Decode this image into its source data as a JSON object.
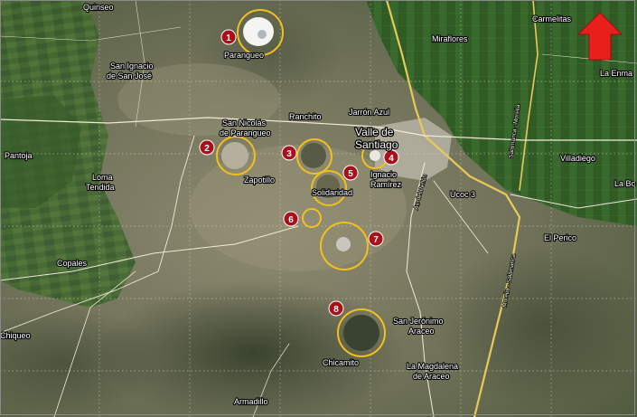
{
  "colors": {
    "crater_ring": "#f2c01e",
    "marker_fill": "#a8101a",
    "arrow": "#e8201c",
    "road_major": "#e8c95a",
    "road_minor": "#f0ead8"
  },
  "north_arrow": {
    "icon": "north-arrow-icon"
  },
  "towns": [
    "Quinseo",
    "San Ignacio de San José",
    "Parangueo",
    "Carmelitas",
    "Miraflores",
    "La Enma",
    "Ranchito",
    "Jarrón Azul",
    "San Nicolás de Parangueo",
    "Valle de Santiago",
    "Pantoja",
    "Zapotillo",
    "Ignacio Ramírez",
    "Villadiego",
    "Loma Tendida",
    "Solidaridad",
    "Ucoc 3",
    "La Bo",
    "El Perico",
    "Copales",
    "Chiqueo",
    "San Jerónimo Araceo",
    "Chicamito",
    "La Magdalena de Araceo",
    "Armadillo"
  ],
  "road_labels": [
    "Salamanca - Morelia",
    "Morelia - Salamanca",
    "Av. del Peñón"
  ],
  "craters": [
    {
      "number": "1"
    },
    {
      "number": "2"
    },
    {
      "number": "3"
    },
    {
      "number": "4"
    },
    {
      "number": "5"
    },
    {
      "number": "6"
    },
    {
      "number": "7"
    },
    {
      "number": "8"
    }
  ]
}
